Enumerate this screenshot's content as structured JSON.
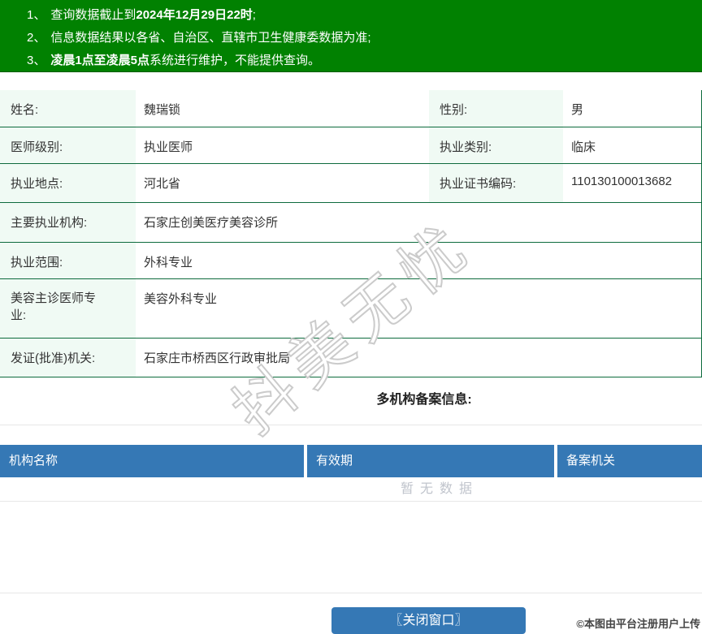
{
  "notice": {
    "lines": [
      {
        "num": "1、",
        "pre": "查询数据截止到",
        "bold": "2024年12月29日22时",
        "post": ";"
      },
      {
        "num": "2、",
        "pre": "信息数据结果以各省、自治区、直辖市卫生健康委数据为准;",
        "bold": "",
        "post": ""
      },
      {
        "num": "3、",
        "pre": "",
        "bold": "凌晨1点至凌晨5点",
        "post": "系统进行维护，不能提供查询。"
      }
    ]
  },
  "info": {
    "rows": [
      {
        "label": "姓名:",
        "value": "魏瑞锁",
        "label2": "性别:",
        "value2": "男"
      },
      {
        "label": "医师级别:",
        "value": "执业医师",
        "label2": "执业类别:",
        "value2": "临床"
      },
      {
        "label": "执业地点:",
        "value": "河北省",
        "label2": "执业证书编码:",
        "value2": "110130100013682"
      },
      {
        "label": "主要执业机构:",
        "value": "石家庄创美医疗美容诊所"
      },
      {
        "label": "执业范围:",
        "value": "外科专业"
      },
      {
        "label": "美容主诊医师专业:",
        "value": "美容外科专业"
      },
      {
        "label": "发证(批准)机关:",
        "value": "石家庄市桥西区行政审批局"
      }
    ]
  },
  "registration": {
    "title": "多机构备案信息:",
    "columns": [
      "机构名称",
      "有效期",
      "备案机关"
    ],
    "empty_text": "暂无数据"
  },
  "watermark": "抖美无忧",
  "footer": {
    "close_button": "〖关闭窗口〗",
    "attribution": "©本图由平台注册用户上传"
  },
  "colors": {
    "notice_green": "#018101",
    "table_line_green": "#0d6b3d",
    "label_mint": "#f0faf4",
    "header_blue": "#3578b5",
    "empty_text_gray": "#c0c4cc"
  }
}
